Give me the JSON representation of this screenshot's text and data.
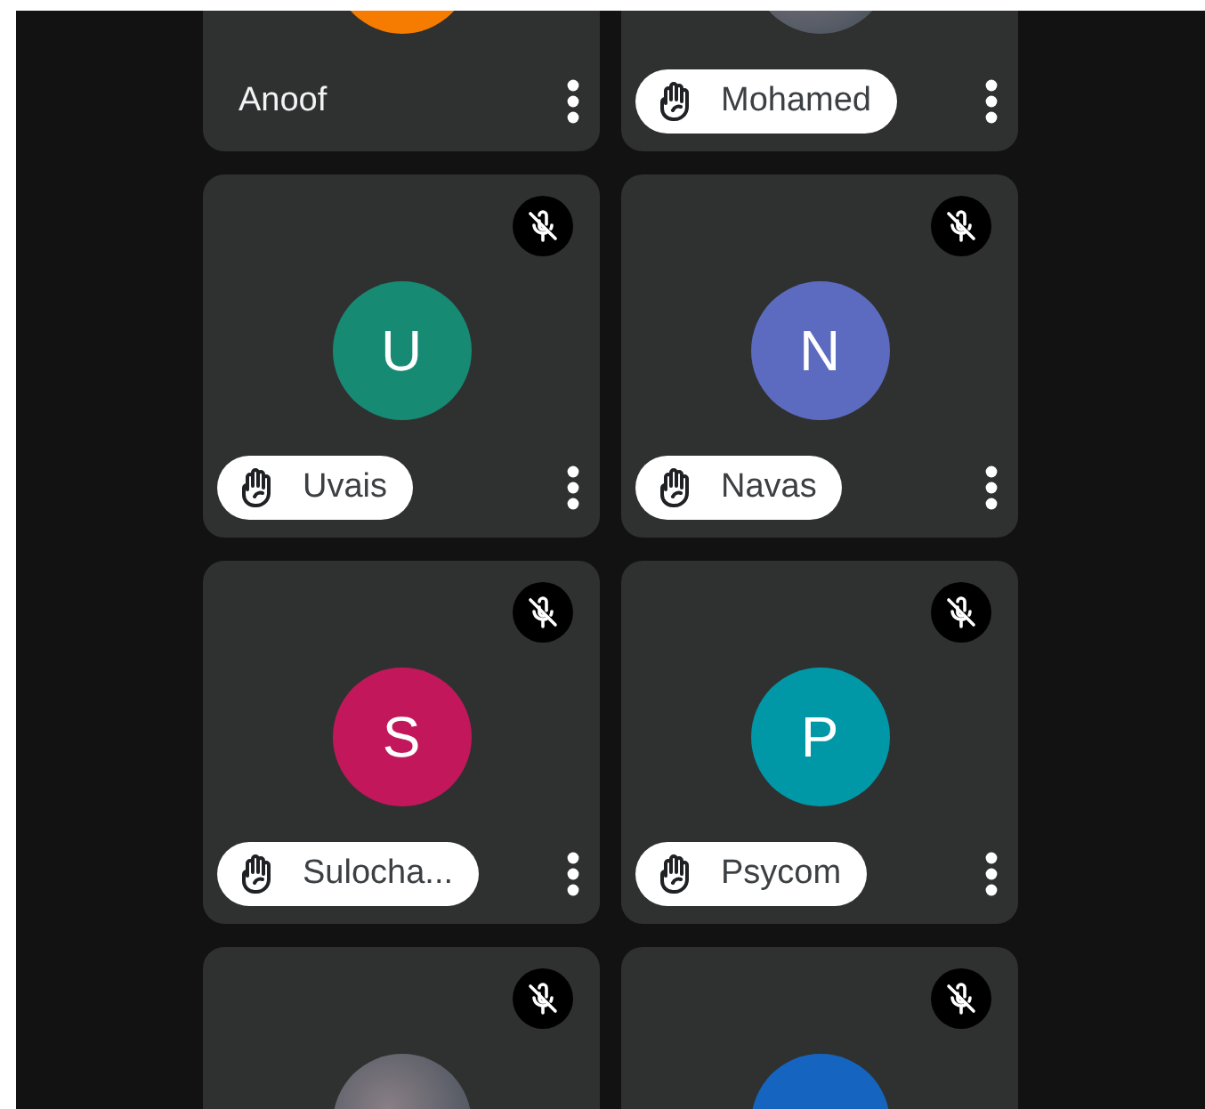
{
  "tiles": [
    {
      "name": "Anoof",
      "hand_raised": false,
      "avatar": {
        "kind": "letter",
        "color": "#f57c00"
      }
    },
    {
      "name": "Mohamed",
      "hand_raised": true,
      "avatar": {
        "kind": "photo"
      }
    },
    {
      "name": "Uvais",
      "hand_raised": true,
      "muted": true,
      "avatar": {
        "kind": "letter",
        "letter": "U",
        "color": "#178a73"
      }
    },
    {
      "name": "Navas",
      "hand_raised": true,
      "muted": true,
      "avatar": {
        "kind": "letter",
        "letter": "N",
        "color": "#5c6bc0"
      }
    },
    {
      "name": "Sulocha...",
      "hand_raised": true,
      "muted": true,
      "avatar": {
        "kind": "letter",
        "letter": "S",
        "color": "#c2185b"
      }
    },
    {
      "name": "Psycom",
      "hand_raised": true,
      "muted": true,
      "avatar": {
        "kind": "letter",
        "letter": "P",
        "color": "#0097a7"
      }
    },
    {
      "muted": true,
      "avatar": {
        "kind": "photo"
      }
    },
    {
      "muted": true,
      "avatar": {
        "kind": "letter",
        "color": "#1565c0"
      }
    }
  ]
}
